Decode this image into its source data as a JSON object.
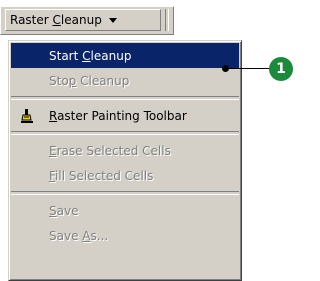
{
  "toolbar": {
    "dropdown": {
      "pre": "Raster ",
      "accel": "C",
      "post": "leanup",
      "arrow_icon": "chevron-down-icon"
    }
  },
  "menu": {
    "items": [
      {
        "pre": "Start ",
        "accel": "C",
        "post": "leanup",
        "state": "selected"
      },
      {
        "pre": "Sto",
        "accel": "p",
        "post": " Cleanup",
        "state": "disabled"
      },
      {
        "pre": "",
        "accel": "R",
        "post": "aster Painting Toolbar",
        "state": "enabled",
        "icon": "paint-brush-icon"
      },
      {
        "pre": "",
        "accel": "E",
        "post": "rase Selected Cells",
        "state": "disabled"
      },
      {
        "pre": "",
        "accel": "F",
        "post": "ill Selected Cells",
        "state": "disabled"
      },
      {
        "pre": "",
        "accel": "S",
        "post": "ave",
        "state": "disabled"
      },
      {
        "pre": "Save ",
        "accel": "A",
        "post": "s...",
        "state": "disabled"
      }
    ]
  },
  "callout": {
    "number": "1",
    "color": "#1b8a3a"
  },
  "colors": {
    "menu_bg": "#d4d0c8",
    "highlight": "#0a246a",
    "disabled_text": "#808080"
  }
}
